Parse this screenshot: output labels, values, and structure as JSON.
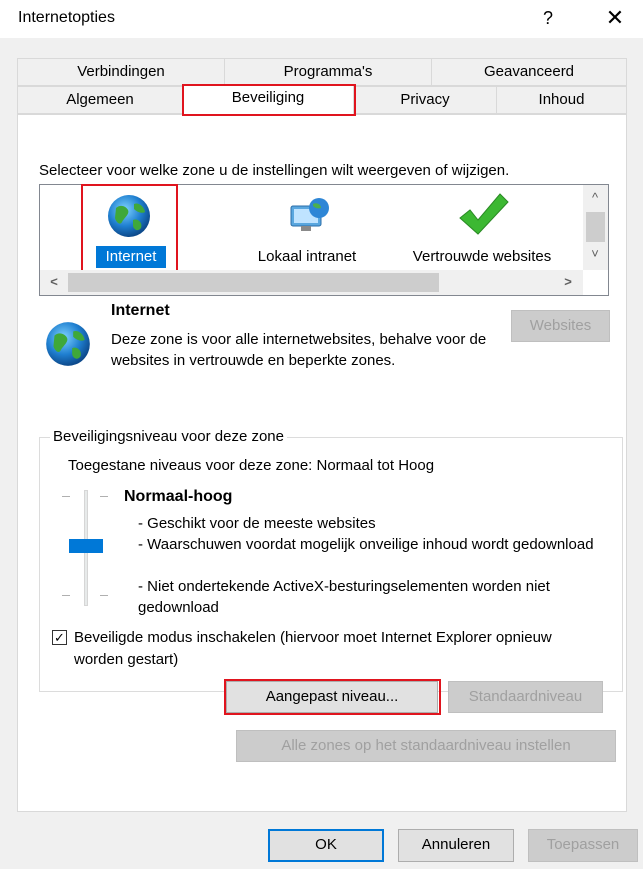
{
  "window": {
    "title": "Internetopties",
    "help_label": "?",
    "close_label": "✕"
  },
  "tabs": {
    "row1": [
      "Verbindingen",
      "Programma's",
      "Geavanceerd"
    ],
    "row2": [
      "Algemeen",
      "Beveiliging",
      "Privacy",
      "Inhoud"
    ],
    "active": "Beveiliging"
  },
  "zones": {
    "instruction": "Selecteer voor welke zone u de instellingen wilt weergeven of wijzigen.",
    "items": [
      {
        "label": "Internet",
        "icon": "globe-icon",
        "selected": true
      },
      {
        "label": "Lokaal intranet",
        "icon": "intranet-icon",
        "selected": false
      },
      {
        "label": "Vertrouwde websites",
        "icon": "checkmark-icon",
        "selected": false
      }
    ],
    "scroll_up": "^",
    "scroll_down": "˅",
    "scroll_left": "<",
    "scroll_right": ">"
  },
  "zone_info": {
    "name": "Internet",
    "description": "Deze zone is voor alle internetwebsites, behalve voor de websites in vertrouwde en beperkte zones.",
    "websites_button": "Websites"
  },
  "security_level": {
    "group_title": "Beveiligingsniveau voor deze zone",
    "allowed_levels": "Toegestane niveaus voor deze zone: Normaal tot Hoog",
    "level_name": "Normaal-hoog",
    "bullets": [
      "- Geschikt voor de meeste websites",
      "- Waarschuwen voordat mogelijk onveilige inhoud wordt gedownload",
      "- Niet ondertekende ActiveX-besturingselementen worden niet gedownload"
    ],
    "protected_mode_label": "Beveiligde modus inschakelen (hiervoor moet Internet Explorer opnieuw worden gestart)",
    "protected_mode_checked": true,
    "custom_level_button": "Aangepast niveau...",
    "default_level_button": "Standaardniveau"
  },
  "reset_all_button": "Alle zones op het standaardniveau instellen",
  "footer": {
    "ok": "OK",
    "cancel": "Annuleren",
    "apply": "Toepassen"
  },
  "colors": {
    "highlight_red": "#e0141e",
    "selection_blue": "#0078d7",
    "dialog_bg": "#f0f0f0"
  }
}
